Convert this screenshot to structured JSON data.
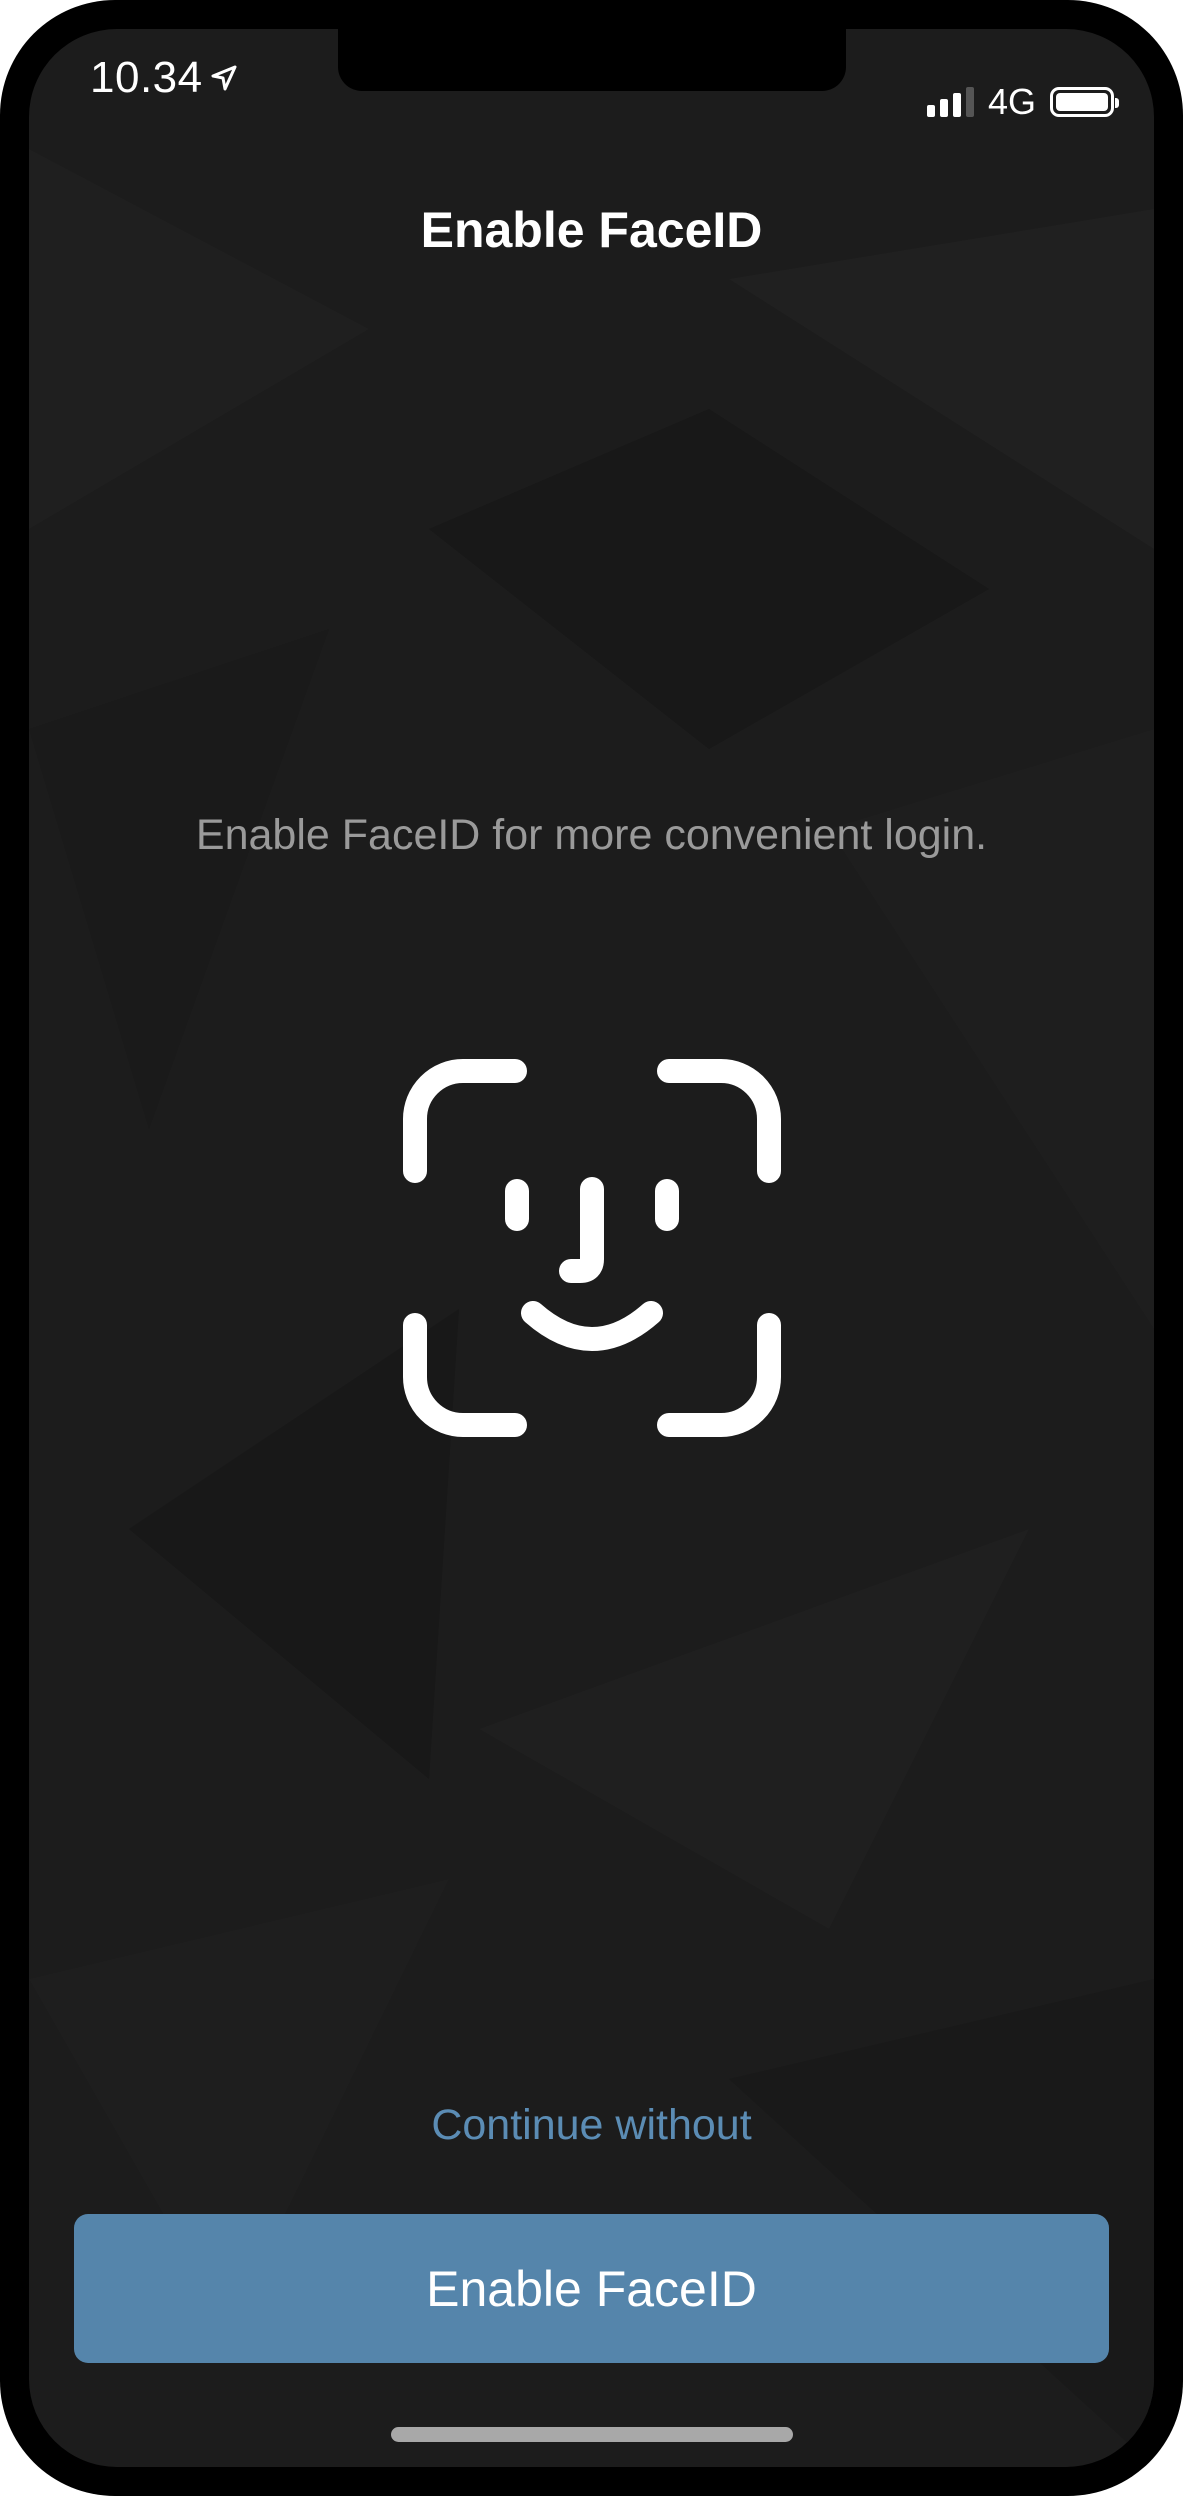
{
  "status_bar": {
    "time": "10.34",
    "network": "4G",
    "location_icon": "location-arrow-icon",
    "signal_icon": "cellular-signal-icon",
    "battery_icon": "battery-icon"
  },
  "header": {
    "title": "Enable FaceID"
  },
  "main": {
    "description": "Enable FaceID for more convenient login.",
    "icon": "face-id-icon"
  },
  "actions": {
    "continue_label": "Continue without",
    "enable_label": "Enable FaceID"
  },
  "colors": {
    "background": "#1c1c1c",
    "accent_button": "#5585ab",
    "link": "#5b8cb4",
    "description_text": "#9a9a9a"
  }
}
